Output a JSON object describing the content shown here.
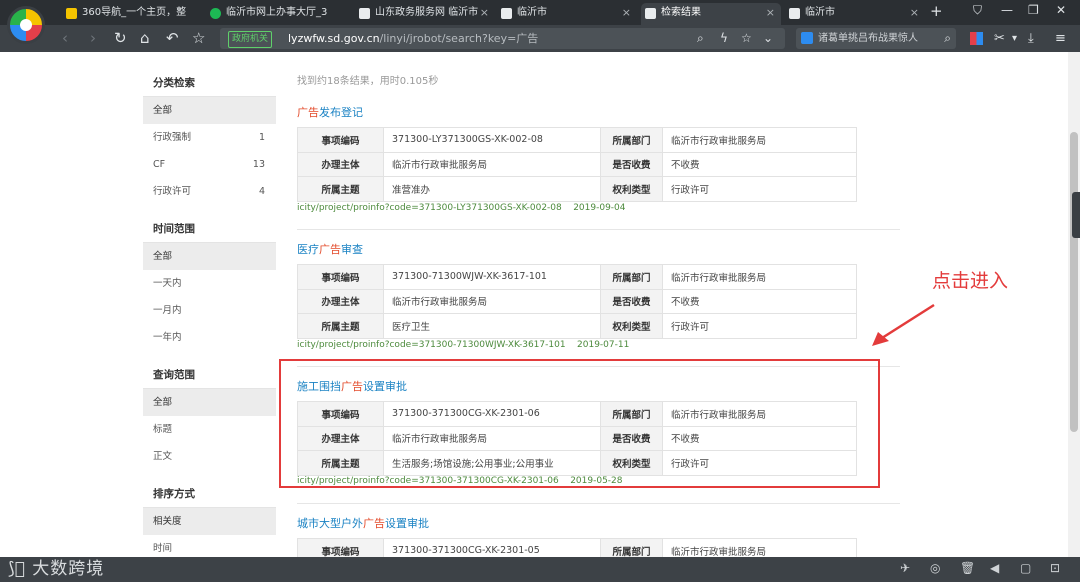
{
  "tabs": [
    {
      "title": "360导航_一个主页，整",
      "active": false
    },
    {
      "title": "临沂市网上办事大厅_3",
      "active": false
    },
    {
      "title": "山东政务服务网 临沂市",
      "active": false
    },
    {
      "title": "临沂市",
      "active": false
    },
    {
      "title": "检索结果",
      "active": true
    },
    {
      "title": "临沂市",
      "active": false
    }
  ],
  "address": {
    "badge": "政府机关",
    "domain": "lyzwfw.sd.gov.cn",
    "path": "/linyi/jrobot/search?key=广告"
  },
  "side_search": {
    "placeholder": "诸葛单挑吕布战果惊人"
  },
  "sidebar": {
    "sections": [
      {
        "title": "分类检索",
        "items": [
          {
            "label": "全部",
            "count": "",
            "selected": true
          },
          {
            "label": "行政强制",
            "count": "1",
            "selected": false
          },
          {
            "label": "CF",
            "count": "13",
            "selected": false
          },
          {
            "label": "行政许可",
            "count": "4",
            "selected": false
          }
        ]
      },
      {
        "title": "时间范围",
        "items": [
          {
            "label": "全部",
            "count": "",
            "selected": true
          },
          {
            "label": "一天内",
            "count": "",
            "selected": false
          },
          {
            "label": "一月内",
            "count": "",
            "selected": false
          },
          {
            "label": "一年内",
            "count": "",
            "selected": false
          }
        ]
      },
      {
        "title": "查询范围",
        "items": [
          {
            "label": "全部",
            "count": "",
            "selected": true
          },
          {
            "label": "标题",
            "count": "",
            "selected": false
          },
          {
            "label": "正文",
            "count": "",
            "selected": false
          }
        ]
      },
      {
        "title": "排序方式",
        "items": [
          {
            "label": "相关度",
            "count": "",
            "selected": true
          },
          {
            "label": "时间",
            "count": "",
            "selected": false
          }
        ]
      }
    ]
  },
  "summary": "找到约18条结果，用时0.105秒",
  "results": [
    {
      "title_pre": "",
      "title_hl": "广告",
      "title_post": "发布登记",
      "rows": [
        {
          "k1": "事项编码",
          "v1": "371300-LY371300GS-XK-002-08",
          "k2": "所属部门",
          "v2": "临沂市行政审批服务局"
        },
        {
          "k1": "办理主体",
          "v1": "临沂市行政审批服务局",
          "k2": "是否收费",
          "v2": "不收费"
        },
        {
          "k1": "所属主题",
          "v1": "准营准办",
          "k2": "权利类型",
          "v2": "行政许可"
        }
      ],
      "url": "icity/project/proinfo?code=371300-LY371300GS-XK-002-08",
      "date": "2019-09-04"
    },
    {
      "title_pre": "医疗",
      "title_hl": "广告",
      "title_post": "审查",
      "rows": [
        {
          "k1": "事项编码",
          "v1": "371300-71300WJW-XK-3617-101",
          "k2": "所属部门",
          "v2": "临沂市行政审批服务局"
        },
        {
          "k1": "办理主体",
          "v1": "临沂市行政审批服务局",
          "k2": "是否收费",
          "v2": "不收费"
        },
        {
          "k1": "所属主题",
          "v1": "医疗卫生",
          "k2": "权利类型",
          "v2": "行政许可"
        }
      ],
      "url": "icity/project/proinfo?code=371300-71300WJW-XK-3617-101",
      "date": "2019-07-11"
    },
    {
      "title_pre": "施工围挡",
      "title_hl": "广告",
      "title_post": "设置审批",
      "rows": [
        {
          "k1": "事项编码",
          "v1": "371300-371300CG-XK-2301-06",
          "k2": "所属部门",
          "v2": "临沂市行政审批服务局"
        },
        {
          "k1": "办理主体",
          "v1": "临沂市行政审批服务局",
          "k2": "是否收费",
          "v2": "不收费"
        },
        {
          "k1": "所属主题",
          "v1": "生活服务;场馆设施;公用事业;公用事业",
          "k2": "权利类型",
          "v2": "行政许可"
        }
      ],
      "url": "icity/project/proinfo?code=371300-371300CG-XK-2301-06",
      "date": "2019-05-28"
    },
    {
      "title_pre": "城市大型户外",
      "title_hl": "广告",
      "title_post": "设置审批",
      "rows": [
        {
          "k1": "事项编码",
          "v1": "371300-371300CG-XK-2301-05",
          "k2": "所属部门",
          "v2": "临沂市行政审批服务局"
        }
      ],
      "url": "",
      "date": ""
    }
  ],
  "annotation": {
    "text": "点击进入",
    "color": "#e33b3b"
  },
  "watermark": "大数跨境",
  "colors": {
    "link": "#1a82c3",
    "highlight": "#e34a2a",
    "url": "#4c8a3c"
  }
}
